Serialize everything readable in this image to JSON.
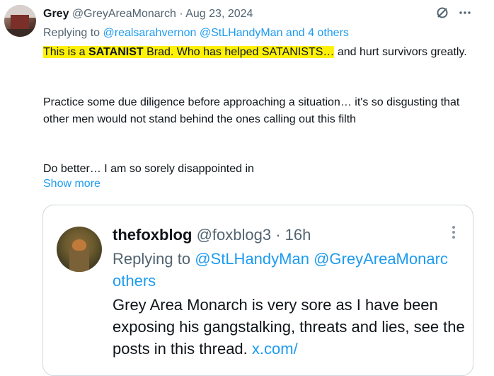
{
  "tweet": {
    "author_name": "Grey",
    "author_handle": "@GreyAreaMonarch",
    "separator": "·",
    "date": "Aug 23, 2024",
    "replying_prefix": "Replying to",
    "replying_to": [
      "@realsarahvernon",
      "@StLHandyMan"
    ],
    "replying_and": "and",
    "replying_others": "4 others",
    "body": {
      "hl_1": "This is a ",
      "hl_bold": "SATANIST",
      "hl_2": " Brad. Who has helped SATANISTS…",
      "rest": " and hurt survivors greatly.",
      "para2": "Practice some due diligence before approaching a situation… it's so disgusting that other men would not stand behind the ones calling out this filth",
      "para3": "Do better… I am so sorely disappointed in"
    },
    "show_more": "Show more",
    "icons": [
      "grok-icon",
      "more-icon"
    ]
  },
  "quote": {
    "author_name": "thefoxblog",
    "author_handle": "@foxblog3",
    "separator": "·",
    "time": "16h",
    "replying_prefix": "Replying to",
    "replying_to": [
      "@StLHandyMan",
      "@GreyAreaMonarc"
    ],
    "replying_others": "others",
    "text": "Grey Area Monarch is very sore as I have been exposing his gangstalking, threats and lies, see the posts in this thread.",
    "link": "x.com/"
  }
}
